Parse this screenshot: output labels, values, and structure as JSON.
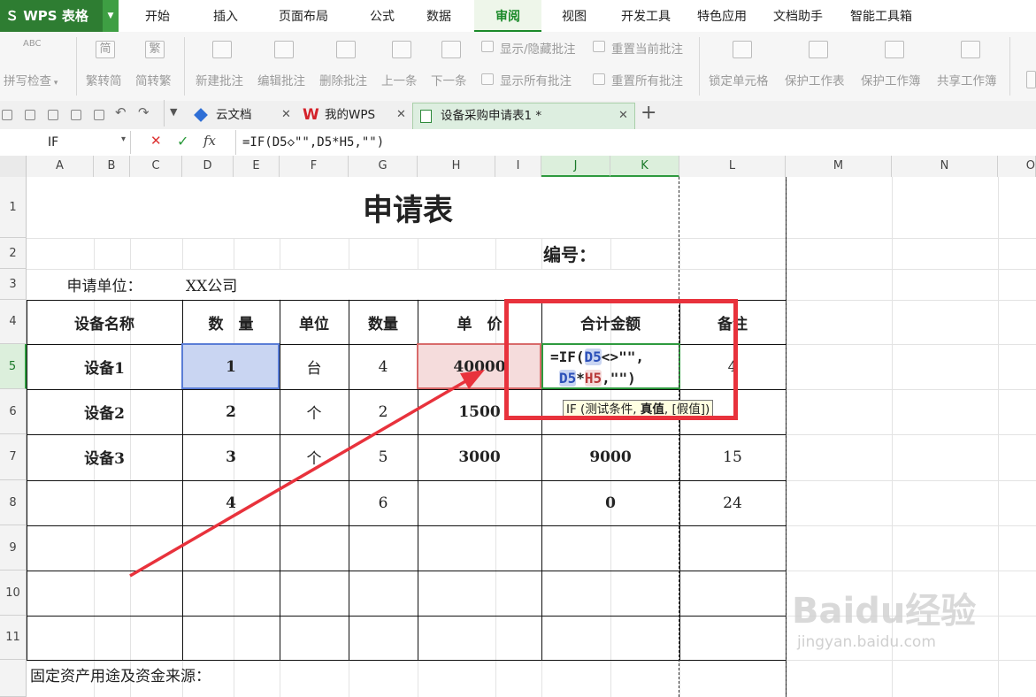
{
  "app": {
    "logo_text": "WPS 表格",
    "logo_icon": "wps-s-logo"
  },
  "menu": {
    "tabs": [
      "开始",
      "插入",
      "页面布局",
      "公式",
      "数据",
      "审阅",
      "视图",
      "开发工具",
      "特色应用",
      "文档助手",
      "智能工具箱"
    ],
    "active": "审阅"
  },
  "ribbon": {
    "spell_check": "拼写检查",
    "trad_to_simp": "繁转简",
    "simp_to_trad": "简转繁",
    "new_comment": "新建批注",
    "edit_comment": "编辑批注",
    "delete_comment": "删除批注",
    "prev": "上一条",
    "next": "下一条",
    "show_hide_comment": "显示/隐藏批注",
    "show_all_comments": "显示所有批注",
    "reset_current_comment": "重置当前批注",
    "reset_all_comments": "重置所有批注",
    "lock_cell": "锁定单元格",
    "protect_sheet": "保护工作表",
    "protect_workbook": "保护工作簿",
    "share_workbook": "共享工作簿",
    "icon_labels": {
      "abc": "ABC",
      "jian": "简",
      "fan": "繁"
    }
  },
  "doc_tabs": [
    {
      "label": "云文档",
      "icon": "cloud-doc-icon"
    },
    {
      "label": "我的WPS",
      "icon": "wps-w-icon"
    },
    {
      "label": "设备采购申请表1 *",
      "icon": "spreadsheet-icon",
      "active": true
    }
  ],
  "formula_bar": {
    "name_box": "IF",
    "fx": "fx",
    "cancel": "✕",
    "confirm": "✓",
    "formula": "=IF(D5◇\"\",D5*H5,\"\")"
  },
  "columns": [
    "A",
    "B",
    "C",
    "D",
    "E",
    "F",
    "G",
    "H",
    "I",
    "J",
    "K",
    "L",
    "M",
    "N",
    "O"
  ],
  "rows": [
    "1",
    "2",
    "3",
    "4",
    "5",
    "6",
    "7",
    "8",
    "9",
    "10",
    "11"
  ],
  "sheet": {
    "title": "申请表",
    "number_label": "编号：",
    "applicant_label": "申请单位：",
    "applicant_value": "XX公司",
    "headers": {
      "name": "设备名称",
      "qty": "数　量",
      "unit": "单位",
      "count": "数量",
      "price": "单　价",
      "total": "合计金额",
      "note": "备注"
    },
    "data_rows": [
      {
        "name": "设备1",
        "qty": "1",
        "unit": "台",
        "count": "4",
        "price": "40000",
        "total": "",
        "note": "4"
      },
      {
        "name": "设备2",
        "qty": "2",
        "unit": "个",
        "count": "2",
        "price": "1500",
        "total": "",
        "note": ""
      },
      {
        "name": "设备3",
        "qty": "3",
        "unit": "个",
        "count": "5",
        "price": "3000",
        "total": "9000",
        "note": "15"
      },
      {
        "name": "",
        "qty": "4",
        "unit": "",
        "count": "6",
        "price": "",
        "total": "0",
        "note": "24"
      }
    ],
    "editing_formula": {
      "prefix": "=IF(",
      "ref1": "D5",
      "mid": "<>\"\",",
      "ref2": "D5",
      "op": "*",
      "ref3": "H5",
      "suffix": ",\"\")"
    },
    "tooltip": {
      "func": "IF (",
      "args": "测试条件, ",
      "current": "真值",
      "rest": ", [假值])"
    },
    "footer_label": "固定资产用途及资金来源："
  },
  "overlay": {
    "accent": "#e8323c",
    "watermark": "Baidu经验",
    "watermark_url": "jingyan.baidu.com"
  }
}
